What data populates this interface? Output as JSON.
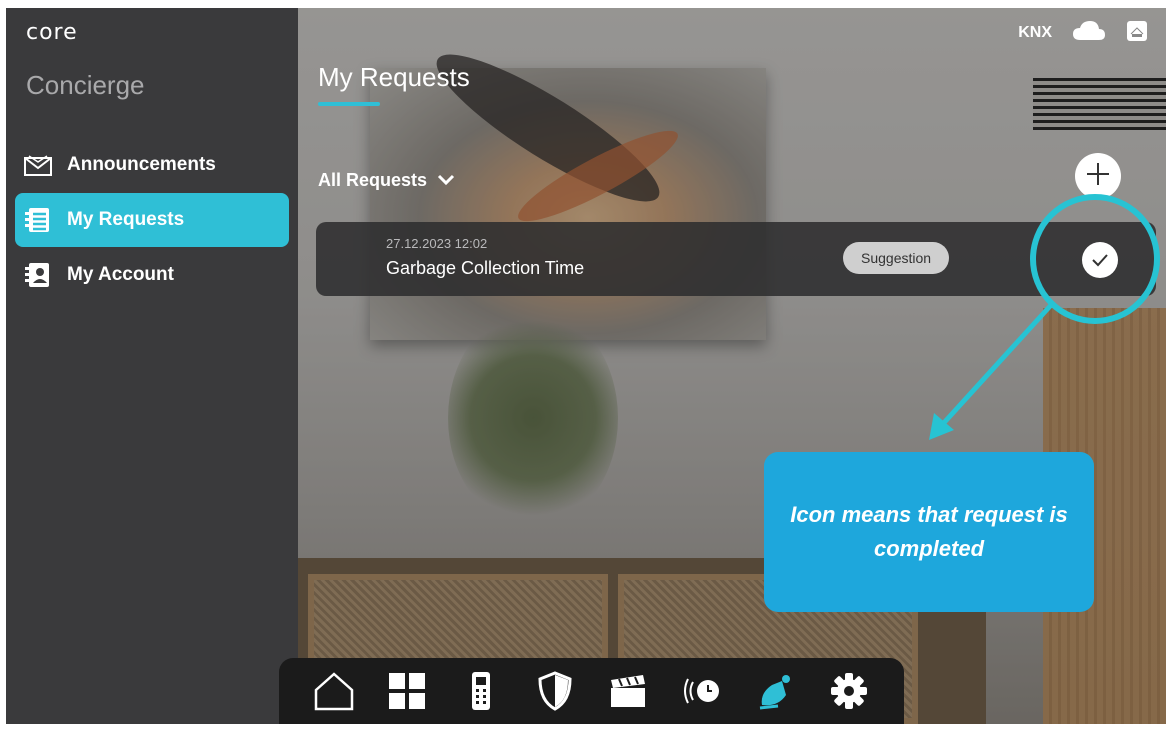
{
  "app": {
    "logo": "core",
    "section": "Concierge"
  },
  "status": {
    "bus_label": "KNX",
    "cloud_icon": "cloud-icon",
    "home_icon": "home-box-icon"
  },
  "sidebar": {
    "items": [
      {
        "label": "Announcements",
        "icon": "envelope-icon",
        "active": false
      },
      {
        "label": "My Requests",
        "icon": "list-icon",
        "active": true
      },
      {
        "label": "My Account",
        "icon": "contact-book-icon",
        "active": false
      }
    ]
  },
  "main": {
    "title": "My Requests",
    "filter_label": "All Requests",
    "add_icon": "plus-icon",
    "requests": [
      {
        "datetime": "27.12.2023 12:02",
        "title": "Garbage Collection Time",
        "category": "Suggestion",
        "status_icon": "checkmark-icon"
      }
    ]
  },
  "annotation": {
    "text": "Icon means that request is completed"
  },
  "dock": {
    "items": [
      "home-icon",
      "grid-icon",
      "intercom-icon",
      "shield-icon",
      "clapperboard-icon",
      "sensor-icon",
      "concierge-bell-icon",
      "settings-gear-icon"
    ],
    "active": "concierge-bell-icon"
  },
  "colors": {
    "accent": "#2fbfd6",
    "callout": "#1ea7dc",
    "sidebar": "#3a3a3c"
  }
}
